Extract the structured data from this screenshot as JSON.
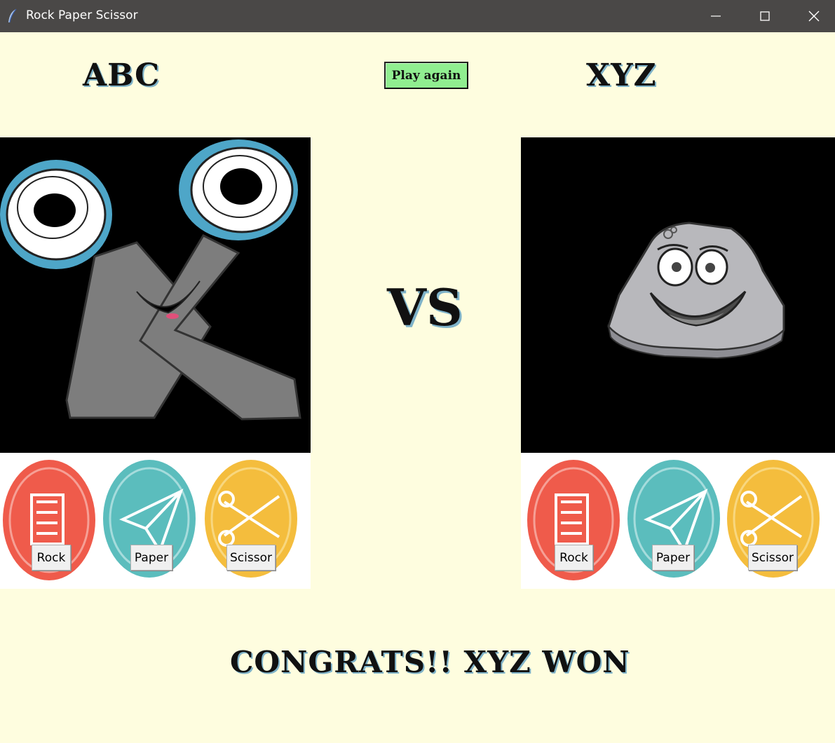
{
  "window": {
    "title": "Rock Paper Scissor",
    "app_icon": "feather-icon",
    "controls": [
      "minimize-icon",
      "maximize-icon",
      "close-icon"
    ]
  },
  "game": {
    "player_left": "ABC",
    "player_right": "XYZ",
    "play_again_label": "Play again",
    "play_again_color": "#90ee90",
    "vs_label": "VS",
    "left_choice_image": "scissors-character",
    "right_choice_image": "rock-character",
    "left_buttons": {
      "rock": "Rock",
      "paper": "Paper",
      "scissor": "Scissor"
    },
    "right_buttons": {
      "rock": "Rock",
      "paper": "Paper",
      "scissor": "Scissor"
    },
    "result": "CONGRATS!! XYZ WON"
  },
  "colors": {
    "background": "#fefddf",
    "rock_badge": "#ef5b4b",
    "paper_badge": "#5bbdbd",
    "scissor_badge": "#f4bd3d"
  }
}
